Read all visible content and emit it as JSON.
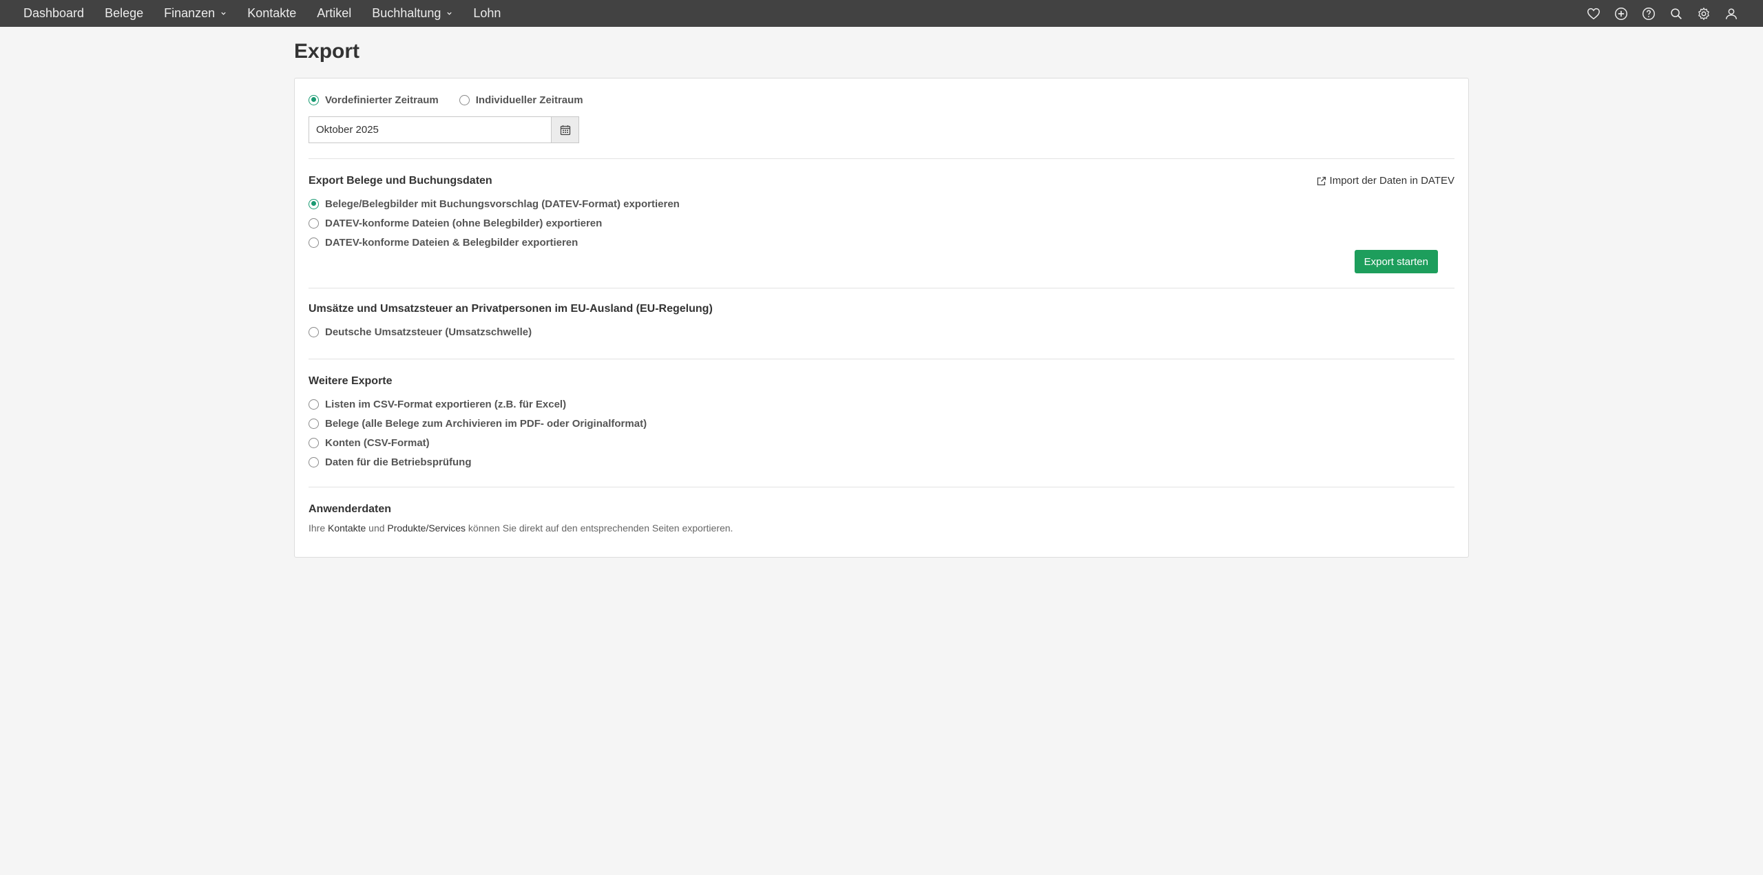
{
  "nav": {
    "items": [
      {
        "label": "Dashboard",
        "dropdown": false
      },
      {
        "label": "Belege",
        "dropdown": false
      },
      {
        "label": "Finanzen",
        "dropdown": true
      },
      {
        "label": "Kontakte",
        "dropdown": false
      },
      {
        "label": "Artikel",
        "dropdown": false
      },
      {
        "label": "Buchhaltung",
        "dropdown": true
      },
      {
        "label": "Lohn",
        "dropdown": false
      }
    ],
    "icons": [
      "heart-icon",
      "plus-circle-icon",
      "help-icon",
      "search-icon",
      "gear-icon",
      "user-icon"
    ],
    "bg_color": "#424242"
  },
  "page": {
    "title": "Export"
  },
  "period": {
    "options": [
      "Vordefinierter Zeitraum",
      "Individueller Zeitraum"
    ],
    "selected_index": 0,
    "value": "Oktober 2025"
  },
  "datev": {
    "title": "Export Belege und Buchungsdaten",
    "import_link": "Import der Daten in DATEV",
    "options": [
      "Belege/Belegbilder mit Buchungsvorschlag (DATEV-Format) exportieren",
      "DATEV-konforme Dateien (ohne Belegbilder) exportieren",
      "DATEV-konforme Dateien & Belegbilder exportieren"
    ],
    "selected_index": 0,
    "button_label": "Export starten"
  },
  "eu": {
    "title": "Umsätze und Umsatzsteuer an Privatpersonen im EU-Ausland (EU-Regelung)",
    "options": [
      "Deutsche Umsatzsteuer (Umsatzschwelle)"
    ]
  },
  "more": {
    "title": "Weitere Exporte",
    "options": [
      "Listen im CSV-Format exportieren (z.B. für Excel)",
      "Belege (alle Belege zum Archivieren im PDF- oder Originalformat)",
      "Konten (CSV-Format)",
      "Daten für die Betriebsprüfung"
    ]
  },
  "userdata": {
    "title": "Anwenderdaten",
    "text_before": "Ihre ",
    "link1": "Kontakte",
    "text_mid": " und ",
    "link2": "Produkte/Services",
    "text_after": " können Sie direkt auf den entsprechenden Seiten exportieren."
  },
  "colors": {
    "accent": "#1a9a72",
    "button": "#1d9e5c"
  }
}
